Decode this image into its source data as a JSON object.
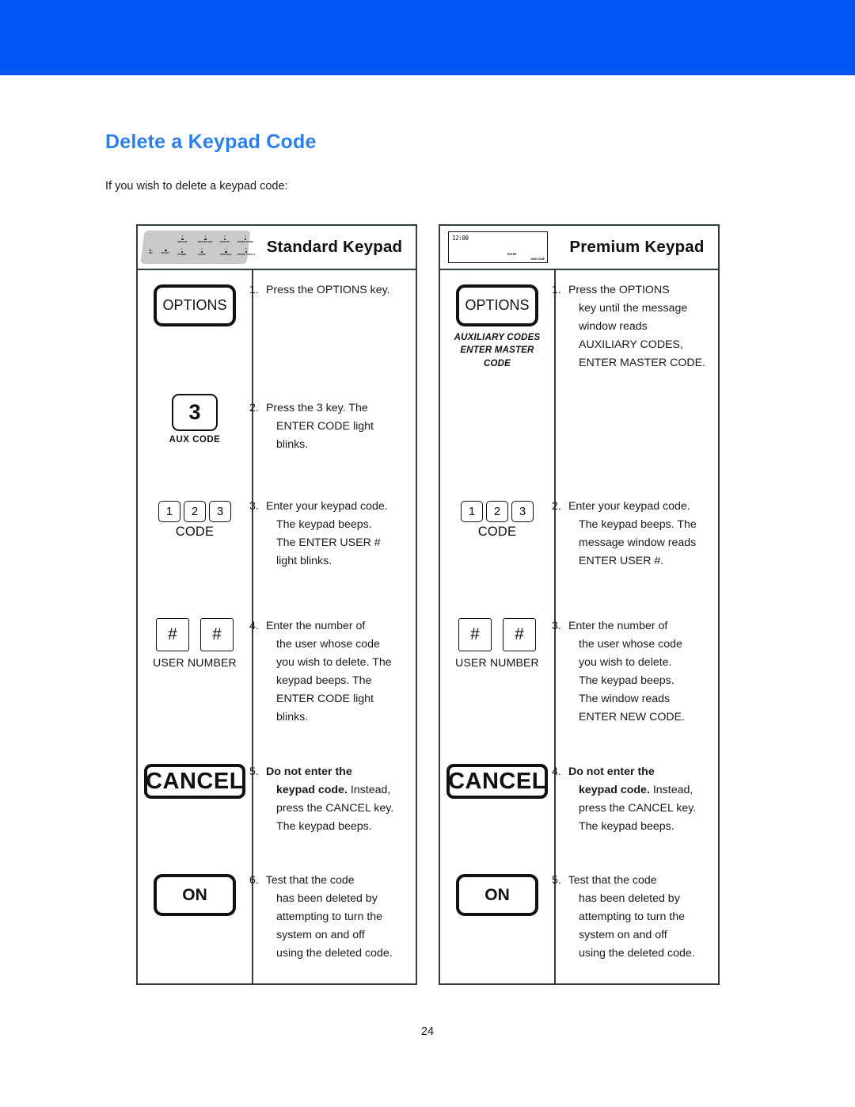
{
  "header_band": {
    "color": "#0055f5"
  },
  "page": {
    "title": "Delete a Keypad Code",
    "title_color": "#2b7ef0",
    "intro": "If you wish to delete a keypad code:",
    "page_number": "24"
  },
  "standard": {
    "header_title": "Standard Keypad",
    "keypad_art": {
      "type": "led-strip",
      "leds_top": [
        {
          "num": "3",
          "label": "INSTANT"
        },
        {
          "num": "4",
          "label": "MOTION OFF"
        },
        {
          "num": "5",
          "label": "BYPASS"
        },
        {
          "num": "6",
          "label": "ENTER CODE"
        }
      ],
      "leds_bottom": [
        {
          "num": "1",
          "label": "POWER"
        },
        {
          "num": "2",
          "label": "CHIME"
        },
        {
          "num": "7",
          "label": "TROUBLE"
        },
        {
          "num": "8",
          "label": "ENTER USER #"
        }
      ],
      "leds_left": [
        {
          "label": "ON"
        },
        {
          "label": "READY"
        }
      ]
    },
    "steps": [
      {
        "key_label": "OPTIONS",
        "caption": "",
        "number": "1.",
        "lines": [
          {
            "text": "Press the OPTIONS key."
          }
        ]
      },
      {
        "key_label": "3",
        "caption": "AUX CODE",
        "number": "2.",
        "lines": [
          {
            "text": "Press the 3 key. The"
          },
          {
            "text": "ENTER CODE light blinks."
          }
        ]
      },
      {
        "key_label": "1 2 3",
        "caption": "CODE",
        "number": "3.",
        "lines": [
          {
            "text": "Enter your keypad code."
          },
          {
            "text": "The keypad beeps."
          },
          {
            "text": "The ENTER USER #"
          },
          {
            "text": "light blinks."
          }
        ]
      },
      {
        "key_label": "# #",
        "caption": "USER NUMBER",
        "number": "4.",
        "lines": [
          {
            "text": "Enter the number of"
          },
          {
            "text": "the user whose code"
          },
          {
            "text": "you wish to delete. The"
          },
          {
            "text": "keypad beeps. The"
          },
          {
            "text": "ENTER CODE light"
          },
          {
            "text": "blinks."
          }
        ]
      },
      {
        "key_label": "CANCEL",
        "caption": "",
        "number": "5.",
        "bold_prefix": "Do not enter the keypad code.",
        "lines": [
          {
            "text": "Do not enter the",
            "bold": true
          },
          {
            "text": "keypad code.",
            "bold": true,
            "trail": " Instead,"
          },
          {
            "text": "press the CANCEL key."
          },
          {
            "text": "The keypad beeps."
          }
        ]
      },
      {
        "key_label": "ON",
        "caption": "",
        "number": "6.",
        "lines": [
          {
            "text": "Test that the code"
          },
          {
            "text": "has been deleted by"
          },
          {
            "text": "attempting to turn the"
          },
          {
            "text": "system on and off"
          },
          {
            "text": "using the deleted code."
          }
        ]
      }
    ]
  },
  "premium": {
    "header_title": "Premium Keypad",
    "keypad_art": {
      "type": "message-window",
      "clock": "12:00",
      "enter_label": "ENTER",
      "newcode_label": "NEW CODE"
    },
    "steps": [
      {
        "key_label": "OPTIONS",
        "caption_lines": [
          "AUXILIARY CODES",
          "ENTER MASTER",
          "CODE"
        ],
        "number": "1.",
        "lines": [
          {
            "text": "Press the OPTIONS"
          },
          {
            "text": "key until the message"
          },
          {
            "text": "window reads"
          },
          {
            "text": "AUXILIARY CODES,"
          },
          {
            "text": "ENTER MASTER CODE."
          }
        ]
      },
      {
        "key_label": "1 2 3",
        "caption": "CODE",
        "number": "2.",
        "lines": [
          {
            "text": "Enter your keypad code."
          },
          {
            "text": "The keypad beeps. The"
          },
          {
            "text": "message window reads"
          },
          {
            "text": "ENTER USER #."
          }
        ]
      },
      {
        "key_label": "# #",
        "caption": "USER NUMBER",
        "number": "3.",
        "lines": [
          {
            "text": "Enter the number of"
          },
          {
            "text": "the user whose code"
          },
          {
            "text": "you wish to delete."
          },
          {
            "text": "The keypad beeps."
          },
          {
            "text": "The window reads"
          },
          {
            "text": "ENTER NEW CODE."
          }
        ]
      },
      {
        "key_label": "CANCEL",
        "caption": "",
        "number": "4.",
        "lines": [
          {
            "text": "Do not enter the",
            "bold": true
          },
          {
            "text": "keypad code.",
            "bold": true,
            "trail": " Instead,"
          },
          {
            "text": "press the CANCEL key."
          },
          {
            "text": "The keypad beeps."
          }
        ]
      },
      {
        "key_label": "ON",
        "caption": "",
        "number": "5.",
        "lines": [
          {
            "text": "Test that the code"
          },
          {
            "text": "has been deleted by"
          },
          {
            "text": "attempting to turn the"
          },
          {
            "text": "system on and off"
          },
          {
            "text": "using the deleted code."
          }
        ]
      }
    ]
  },
  "keys": {
    "code_digits": [
      "1",
      "2",
      "3"
    ],
    "hash_digits": [
      "#",
      "#"
    ]
  }
}
